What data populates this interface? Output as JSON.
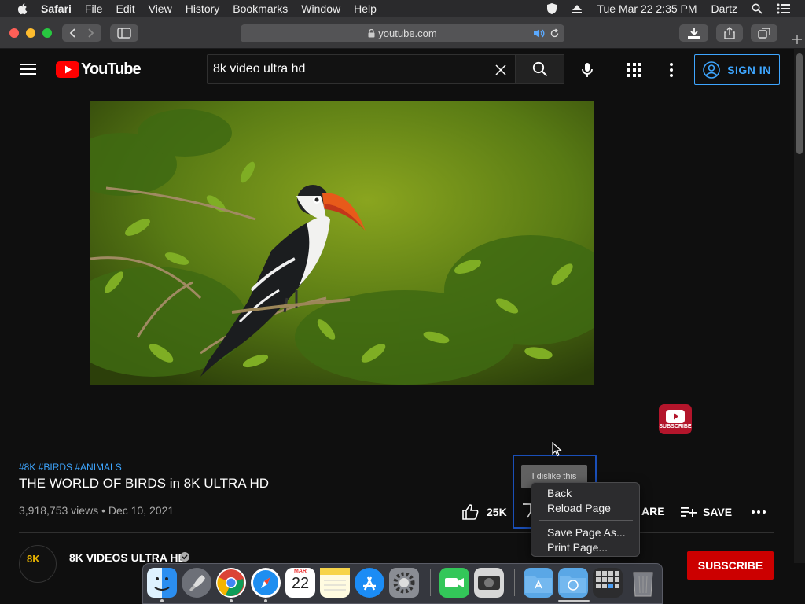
{
  "menubar": {
    "app_name": "Safari",
    "items": [
      "File",
      "Edit",
      "View",
      "History",
      "Bookmarks",
      "Window",
      "Help"
    ],
    "datetime": "Tue Mar 22  2:35 PM",
    "user": "Dartz"
  },
  "browser": {
    "url": "youtube.com"
  },
  "youtube": {
    "logo_text": "YouTube",
    "search": {
      "value": "8k video ultra hd"
    },
    "sign_in_label": "SIGN IN",
    "video": {
      "hashtags": "#8K #BIRDS #ANIMALS",
      "title": "THE WORLD OF BIRDS in 8K ULTRA HD",
      "meta": "3,918,753 views • Dec 10, 2021",
      "like_count": "25K",
      "share_tail": "ARE",
      "save_label": "SAVE",
      "watermark_label": "SUBSCRIBE"
    },
    "channel": {
      "avatar_text": "8K",
      "name": "8K VIDEOS ULTRA HD",
      "subscribe_label": "SUBSCRIBE"
    },
    "dislike_tooltip": "I dislike this"
  },
  "context_menu": {
    "items": [
      "Back",
      "Reload Page",
      "Save Page As...",
      "Print Page..."
    ]
  },
  "dock": {
    "calendar_month": "MAR",
    "calendar_day": "22"
  },
  "colors": {
    "accent_blue": "#3ea6ff",
    "youtube_red": "#ff0000",
    "subscribe_red": "#cc0000"
  }
}
